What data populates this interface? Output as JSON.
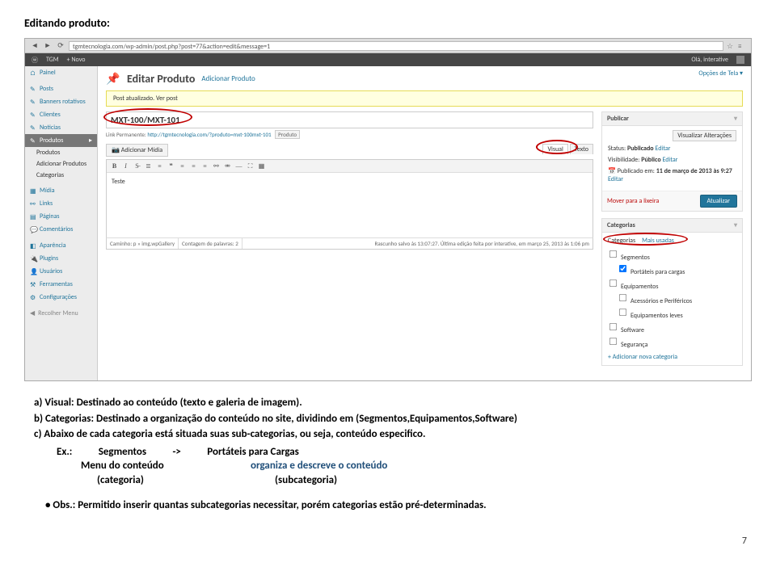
{
  "heading": "Editando produto:",
  "browser": {
    "url": "tgmtecnologia.com/wp-admin/post.php?post=77&action=edit&message=1"
  },
  "wpTop": {
    "site": "TGM",
    "new": "+ Novo",
    "greeting": "Olá, interative"
  },
  "sidebar": {
    "painel": "Painel",
    "posts": "Posts",
    "banners": "Banners rotativos",
    "clientes": "Clientes",
    "noticias": "Noticias",
    "produtos": "Produtos",
    "sub_prod": "Produtos",
    "sub_add": "Adicionar Produtos",
    "sub_cat": "Categorias",
    "midia": "Mídia",
    "links": "Links",
    "paginas": "Páginas",
    "comentarios": "Comentários",
    "aparencia": "Aparência",
    "plugins": "Plugins",
    "usuarios": "Usuários",
    "ferramentas": "Ferramentas",
    "config": "Configurações",
    "recolher": "Recolher Menu"
  },
  "main": {
    "screenOpts": "Opções de Tela ▾",
    "pageTitle": "Editar Produto",
    "addNew": "Adicionar Produto",
    "notice": "Post atualizado. Ver post",
    "titleValue": "MXT-100/MXT-101",
    "permalinkLabel": "Link Permanente:",
    "permalink": "http://tgmtecnologia.com/?produto=mxt-100mxt-101",
    "permalinkBtn1": "Produto",
    "mediaBtn": "Adicionar Mídia",
    "tabVisual": "Visual",
    "tabText": "Texto",
    "bodyText": "Teste",
    "footPath": "Caminho: p » img.wpGallery",
    "footWords": "Contagem de palavras: 2",
    "footDraft": "Rascunho salvo às 13:07:27. Última edição feita por interative, em março 25, 2013 às 1:06 pm"
  },
  "publish": {
    "title": "Publicar",
    "visualize": "Visualizar Alterações",
    "statusLabel": "Status:",
    "statusValue": "Publicado",
    "edit": "Editar",
    "visLabel": "Visibilidade:",
    "visValue": "Público",
    "pubLabel": "Publicado em:",
    "pubValue": "11 de março de 2013 às 9:27",
    "trash": "Mover para a lixeira",
    "update": "Atualizar"
  },
  "cats": {
    "title": "Categorias",
    "tab1": "Categorias",
    "tab2": "Mais usadas",
    "c_seg": "Segmentos",
    "c_port": "Portáteis para cargas",
    "c_equip": "Equipamentos",
    "c_acess": "Acessórios e Periféricos",
    "c_leve": "Equipamentos leves",
    "c_soft": "Software",
    "c_segu": "Segurança",
    "add": "+ Adicionar nova categoria"
  },
  "text": {
    "a": "a)   Visual: Destinado ao conteúdo (texto e galeria de imagem).",
    "b": "b)   Categorias: Destinado a organização do conteúdo no site, dividindo em (Segmentos,Equipamentos,Software)",
    "c": "c)   Abaixo de cada categoria está situada suas sub-categorias, ou seja, conteúdo especifico.",
    "exLabel": "Ex.:",
    "exSeg": "Segmentos",
    "exArrow": "->",
    "exPort": "Portáteis para Cargas",
    "row1l": "Menu do conteúdo",
    "row1r": "organiza e descreve o conteúdo",
    "row2l": "(categoria)",
    "row2r": "(subcategoria)",
    "obs": "•    Obs.:  Permitido inserir quantas subcategorias necessitar, porém categorias estão pré-determinadas.",
    "page": "7"
  }
}
